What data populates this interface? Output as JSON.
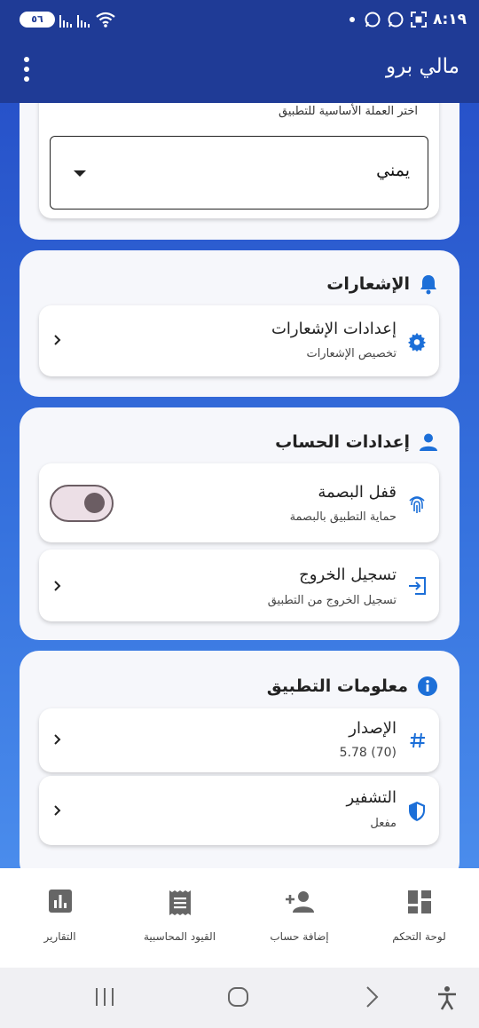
{
  "status_bar": {
    "time": "٨:١٩",
    "battery": "٥٦"
  },
  "app_bar": {
    "title": "مالي برو"
  },
  "currency_section": {
    "subtitle": "اختر العملة الأساسية للتطبيق",
    "selected_currency": "يمني"
  },
  "notifications_section": {
    "title": "الإشعارات",
    "items": [
      {
        "title": "إعدادات الإشعارات",
        "subtitle": "تخصيص الإشعارات",
        "icon": "gear-icon"
      }
    ]
  },
  "account_section": {
    "title": "إعدادات الحساب",
    "items": [
      {
        "title": "قفل البصمة",
        "subtitle": "حماية التطبيق بالبصمة",
        "icon": "fingerprint-icon",
        "toggle_on": false
      },
      {
        "title": "تسجيل الخروج",
        "subtitle": "تسجيل الخروج من التطبيق",
        "icon": "logout-icon"
      }
    ]
  },
  "app_info_section": {
    "title": "معلومات التطبيق",
    "items": [
      {
        "title": "الإصدار",
        "subtitle": "5.78 (70)",
        "icon": "hash-icon"
      },
      {
        "title": "التشفير",
        "subtitle": "مفعل",
        "icon": "shield-icon"
      }
    ]
  },
  "bottom_nav": {
    "items": [
      {
        "label": "لوحة التحكم",
        "icon": "dashboard-icon"
      },
      {
        "label": "إضافة حساب",
        "icon": "add-person-icon"
      },
      {
        "label": "القيود المحاسبية",
        "icon": "receipt-icon"
      },
      {
        "label": "التقارير",
        "icon": "bar-chart-icon"
      }
    ]
  },
  "colors": {
    "primary": "#1f3b96",
    "accent_blue": "#1c6fd8",
    "background_gradient_top": "#2752c9",
    "background_gradient_bottom": "#4a8cec"
  }
}
